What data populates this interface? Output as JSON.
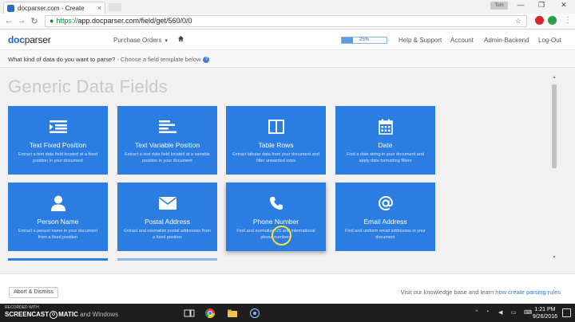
{
  "browser": {
    "tab_title": "docparser.com - Create",
    "tab_close": "×",
    "user_badge": "Tom",
    "window_controls": {
      "minimize": "—",
      "maximize": "❐",
      "close": "✕"
    },
    "nav": {
      "back": "←",
      "forward": "→",
      "reload": "↻"
    },
    "url_scheme": "https://",
    "url_rest": "app.docparser.com/field/get/560/0/0",
    "lock": "🔒",
    "star": "☆"
  },
  "appnav": {
    "logo_doc": "doc",
    "logo_parser": "parser",
    "purchase_orders": "Purchase Orders",
    "caret": "▾",
    "progress_label": "25%",
    "progress_value": 0.25,
    "help_support": "Help & Support",
    "account": "Account",
    "admin_backend": "Admin-Backend",
    "logout": "Log-Out"
  },
  "subheader": {
    "question": "What kind of data do you want to parse?",
    "hint": " - Choose a field template below",
    "help_icon": "?"
  },
  "main": {
    "title": "Generic Data Fields",
    "cards": [
      {
        "title": "Text Fixed Position",
        "desc": "Extract a text data field located at a fixed position in your document",
        "icon": "text-fixed-icon"
      },
      {
        "title": "Text Variable Position",
        "desc": "Extract a text data field located at a variable position in your document",
        "icon": "text-variable-icon"
      },
      {
        "title": "Table Rows",
        "desc": "Extract tabular data from your document and filter unwanted rows",
        "icon": "table-icon"
      },
      {
        "title": "Date",
        "desc": "Find a date string in your document and apply date formatting filters",
        "icon": "calendar-icon"
      },
      {
        "title": "Person Name",
        "desc": "Extract a person name in your document from a fixed position",
        "icon": "person-icon"
      },
      {
        "title": "Postal Address",
        "desc": "Extract and normalize postal addresses from a fixed position",
        "icon": "envelope-icon"
      },
      {
        "title": "Phone Number",
        "desc": "Find and normalize US and international phone numbers",
        "icon": "phone-icon"
      },
      {
        "title": "Email Address",
        "desc": "Find and uniform email addresses in your document",
        "icon": "at-icon"
      }
    ]
  },
  "footer": {
    "abort": "Abort & Dismiss",
    "text": "Visit our knowledge base and learn ",
    "link": "how create parsing rules"
  },
  "taskbar": {
    "recorded_with": "RECORDED WITH",
    "brand_a": "SCREENCAST",
    "brand_o": "O",
    "brand_b": "MATIC",
    "brand_c": " and Windows",
    "time": "1:21 PM",
    "date": "9/26/2016"
  },
  "colors": {
    "accent": "#2b7de2",
    "logo": "#1d64c8",
    "title_grey": "#c9c9c9"
  }
}
